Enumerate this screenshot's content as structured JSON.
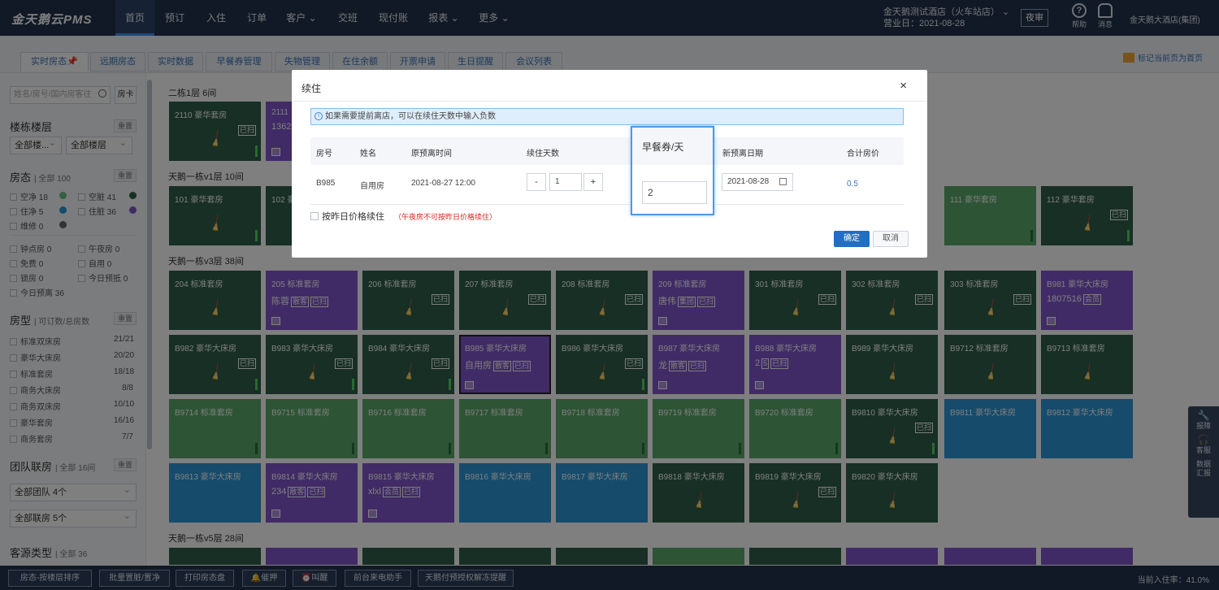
{
  "app": {
    "logo": "金天鹅云PMS"
  },
  "nav": {
    "items": [
      {
        "label": "首页"
      },
      {
        "label": "预订"
      },
      {
        "label": "入住"
      },
      {
        "label": "订单"
      },
      {
        "label": "客户 ⌄"
      },
      {
        "label": "交班"
      },
      {
        "label": "现付账"
      },
      {
        "label": "报表 ⌄"
      },
      {
        "label": "更多 ⌄"
      }
    ],
    "hotel_name": "金天鹅测试酒店（火车站店） ⌄",
    "business_day": "营业日：2021-08-28",
    "night_audit": "夜审",
    "help": "帮助",
    "messages": "消息",
    "group": "金天鹅大酒店(集团)"
  },
  "tabs": [
    "实时房态📌",
    "远期房态",
    "实时数据",
    "早餐券管理",
    "失物管理",
    "在住余额",
    "开票申请",
    "生日提醒",
    "会议列表"
  ],
  "pin_link": "标记当前页为首页",
  "sidebar": {
    "search_placeholder": "姓名/房号/国内房客往",
    "room_card_btn": "房卡",
    "building_title": "楼栋楼层",
    "reset": "重置",
    "building_sel": "全部楼...",
    "floor_sel": "全部楼层",
    "status_title": "房态",
    "status_all": "| 全部 100",
    "statuses": [
      {
        "label": "空净 18",
        "color": "#6fbf7a"
      },
      {
        "label": "空脏 41",
        "color": "#2f5f49"
      },
      {
        "label": "住净 5",
        "color": "#2c96d6"
      },
      {
        "label": "住脏 36",
        "color": "#8057cc"
      },
      {
        "label": "维修 0",
        "color": "#666666"
      }
    ],
    "flags": [
      "钟点房 0",
      "午夜房 0",
      "免费 0",
      "自用 0",
      "锁房 0",
      "今日预抵 0",
      "今日预离 36"
    ],
    "roomtype_title": "房型",
    "roomtype_sub": "| 可订数/总房数",
    "roomtypes": [
      {
        "name": "标准双床房",
        "count": "21/21"
      },
      {
        "name": "豪华大床房",
        "count": "20/20"
      },
      {
        "name": "标准套房",
        "count": "18/18"
      },
      {
        "name": "商务大床房",
        "count": "8/8"
      },
      {
        "name": "商务双床房",
        "count": "10/10"
      },
      {
        "name": "豪华套房",
        "count": "16/16"
      },
      {
        "name": "商务套房",
        "count": "7/7"
      }
    ],
    "team_title": "团队联房",
    "team_sub": "| 全部 16间",
    "team_sel": "全部团队 4个",
    "link_sel": "全部联房 5个",
    "source_title": "客源类型",
    "source_sub": "| 全部 36"
  },
  "floors": {
    "f1": "二栋1层 6间",
    "f2": "天鹅一栋v1层 10间",
    "f3": "天鹅一栋v3层 38间",
    "f4": "天鹅一栋v5层 28间"
  },
  "rooms": {
    "r2110": {
      "name": "2110 豪华套房",
      "tag": "已扫"
    },
    "r2111": {
      "name": "2111",
      "guest": "1362"
    },
    "r101": {
      "name": "101 豪华套房"
    },
    "r102": {
      "name": "102 豪"
    },
    "r111": {
      "name": "111 豪华套房"
    },
    "r112": {
      "name": "112 豪华套房",
      "tag": "已扫"
    },
    "r204": {
      "name": "204 标准套房"
    },
    "r205": {
      "name": "205 标准套房",
      "guest": "陈蓉",
      "tg1": "散客",
      "tg2": "已扫"
    },
    "r206": {
      "name": "206 标准套房",
      "tag": "已扫"
    },
    "r207": {
      "name": "207 标准套房",
      "tag": "已扫"
    },
    "r208": {
      "name": "208 标准套房",
      "tag": "已扫"
    },
    "r209": {
      "name": "209 标准套房",
      "guest": "唐伟",
      "tg1": "集团",
      "tg2": "已扫"
    },
    "r301": {
      "name": "301 标准套房",
      "tag": "已扫"
    },
    "r302": {
      "name": "302 标准套房",
      "tag": "已扫"
    },
    "r303": {
      "name": "303 标准套房",
      "tag": "已扫"
    },
    "rB981": {
      "name": "B981 豪华大床房",
      "guest": "1807516",
      "tg1": "会员"
    },
    "rB982": {
      "name": "B982 豪华大床房",
      "tag": "已扫"
    },
    "rB983": {
      "name": "B983 豪华大床房",
      "tag": "已扫"
    },
    "rB984": {
      "name": "B984 豪华大床房",
      "tag": "已扫"
    },
    "rB985": {
      "name": "B985 豪华大床房",
      "guest": "自用房",
      "tg1": "散客",
      "tg2": "已扫"
    },
    "rB986": {
      "name": "B986 豪华大床房",
      "tag": "已扫"
    },
    "rB987": {
      "name": "B987 豪华大床房",
      "guest": "龙",
      "tg1": "散客",
      "tg2": "已扫"
    },
    "rB988": {
      "name": "B988 豪华大床房",
      "guest": "2",
      "tg1": "5",
      "tg2": "已扫"
    },
    "rB989": {
      "name": "B989 豪华大床房"
    },
    "rB9712": {
      "name": "B9712 标准套房"
    },
    "rB9713": {
      "name": "B9713 标准套房"
    },
    "rB9714": {
      "name": "B9714 标准套房"
    },
    "rB9715": {
      "name": "B9715 标准套房"
    },
    "rB9716": {
      "name": "B9716 标准套房"
    },
    "rB9717": {
      "name": "B9717 标准套房"
    },
    "rB9718": {
      "name": "B9718 标准套房"
    },
    "rB9719": {
      "name": "B9719 标准套房"
    },
    "rB9720": {
      "name": "B9720 标准套房"
    },
    "rB9810": {
      "name": "B9810 豪华大床房",
      "tag": "已扫"
    },
    "rB9811": {
      "name": "B9811 豪华大床房"
    },
    "rB9812": {
      "name": "B9812 豪华大床房"
    },
    "rB9813": {
      "name": "B9813 豪华大床房"
    },
    "rB9814": {
      "name": "B9814 豪华大床房",
      "guest": "234",
      "tg1": "散客",
      "tg2": "已扫"
    },
    "rB9815": {
      "name": "B9815 豪华大床房",
      "guest": "xlxl",
      "tg1": "会员",
      "tg2": "已扫"
    },
    "rB9816": {
      "name": "B9816 豪华大床房"
    },
    "rB9817": {
      "name": "B9817 豪华大床房"
    },
    "rB9818": {
      "name": "B9818 豪华大床房"
    },
    "rB9819": {
      "name": "B9819 豪华大床房",
      "tag": "已扫"
    },
    "rB9820": {
      "name": "B9820 豪华大床房"
    }
  },
  "dock": {
    "repair": "报障",
    "service": "客服",
    "report1": "数据",
    "report2": "汇报"
  },
  "bottom": {
    "sort": "房态-按楼层排序",
    "batch": "批量置脏/置净",
    "print": "打印房态盘",
    "urge": "催押",
    "wake": "叫醒",
    "phone": "前台来电助手",
    "preauth": "天鹅付预授权解冻提醒",
    "occupancy": "当前入住率：41.0%"
  },
  "dialog": {
    "title": "续住",
    "close": "×",
    "notice": "如果需要提前离店，可以在续住天数中输入负数",
    "headers": {
      "room": "房号",
      "name": "姓名",
      "orig": "原预离时间",
      "days": "续住天数",
      "breakfast": "早餐券/天",
      "newdate": "新预离日期",
      "total": "合计房价"
    },
    "row": {
      "room": "B985",
      "name": "自用房",
      "orig": "2021-08-27 12:00",
      "days": "1",
      "breakfast": "2",
      "newdate": "2021-08-28",
      "total": "0.5"
    },
    "minus": "-",
    "plus": "+",
    "yesterday_price": "按昨日价格续住",
    "warn": "（午夜房不可按昨日价格续住）",
    "ok": "确定",
    "cancel": "取消"
  }
}
